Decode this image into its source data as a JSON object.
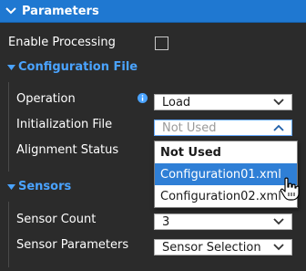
{
  "panel": {
    "title": "Parameters"
  },
  "enable_processing": {
    "label": "Enable Processing",
    "checked": false
  },
  "config_section": {
    "title": "Configuration File",
    "operation": {
      "label": "Operation",
      "value": "Load"
    },
    "initialization_file": {
      "label": "Initialization File",
      "value": "Not Used"
    },
    "alignment_status": {
      "label": "Alignment Status"
    },
    "dropdown_options": [
      "Not Used",
      "Configuration01.xml",
      "Configuration02.xml"
    ]
  },
  "sensors_section": {
    "title": "Sensors",
    "sensor_count": {
      "label": "Sensor Count",
      "value": "3"
    },
    "sensor_parameters": {
      "label": "Sensor Parameters",
      "value": "Sensor Selection"
    }
  },
  "colors": {
    "header_bg": "#1f78d1",
    "section_title": "#4aa3ff",
    "highlight": "#2f7fd6",
    "background": "#2b2b2b"
  }
}
